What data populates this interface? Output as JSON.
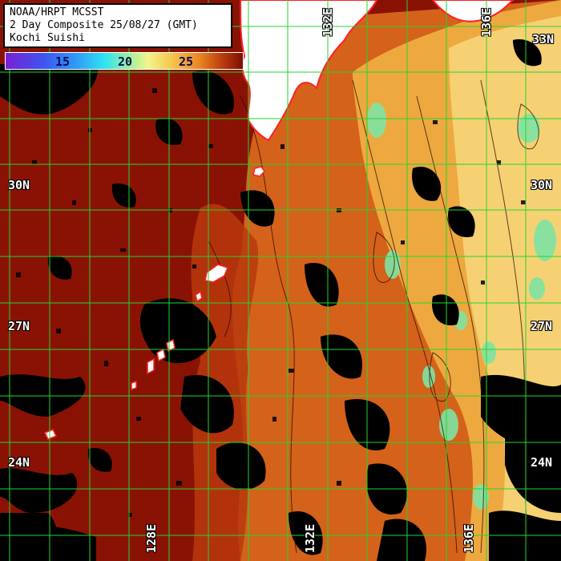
{
  "header": {
    "line1": "NOAA/HRPT MCSST",
    "line2": "2 Day Composite 25/08/27 (GMT)",
    "line3": "Kochi Suishi"
  },
  "legend": {
    "labels": [
      "15",
      "20",
      "25"
    ]
  },
  "grid": {
    "latitude_labels": [
      "33N",
      "30N",
      "27N",
      "24N"
    ],
    "longitude_labels": [
      "128E",
      "132E",
      "136E"
    ]
  },
  "colors": {
    "grid": "#22d62e",
    "coast": "#ff2020",
    "land": "#ffffff",
    "cloud": "#000000",
    "sst_warm": "#8c1106",
    "sst_mid": "#e07a22",
    "sst_cool": "#f2cf63",
    "sst_cold": "#7fe3a3"
  }
}
